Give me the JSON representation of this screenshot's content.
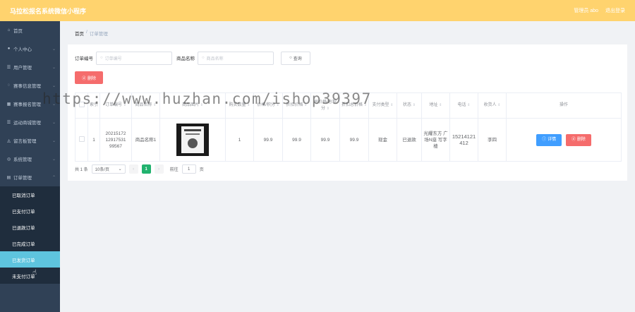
{
  "header": {
    "title": "马拉松报名系统微信小程序",
    "admin_label": "管理员 abo",
    "logout_label": "退出登录"
  },
  "sidebar": {
    "items": [
      {
        "label": "首页",
        "icon": "home-icon",
        "glyph": "⌂"
      },
      {
        "label": "个人中心",
        "icon": "user-icon",
        "glyph": "●"
      },
      {
        "label": "用户管理",
        "icon": "list-icon",
        "glyph": "☰"
      },
      {
        "label": "赛事信息管理",
        "icon": "info-icon",
        "glyph": "◌"
      },
      {
        "label": "赛事报名管理",
        "icon": "calendar-icon",
        "glyph": "▦"
      },
      {
        "label": "运动商城管理",
        "icon": "menu-icon",
        "glyph": "☰"
      },
      {
        "label": "留言板管理",
        "icon": "chat-icon",
        "glyph": "◬"
      },
      {
        "label": "系统管理",
        "icon": "gear-icon",
        "glyph": "◎"
      },
      {
        "label": "订单管理",
        "icon": "order-icon",
        "glyph": "▤"
      }
    ],
    "subitems": [
      {
        "label": "已取消订单"
      },
      {
        "label": "已支付订单"
      },
      {
        "label": "已退款订单"
      },
      {
        "label": "已完成订单"
      },
      {
        "label": "已发货订单"
      },
      {
        "label": "未支付订单"
      }
    ]
  },
  "breadcrumb": {
    "home": "首页",
    "sep": "/",
    "current": "订单管理"
  },
  "search": {
    "order_no_label": "订单编号",
    "order_no_placeholder": "订单编号",
    "product_label": "商品名称",
    "product_placeholder": "商品名称",
    "query_label": "查询",
    "search_glyph": "○"
  },
  "actions": {
    "delete_label": "删除",
    "delete_glyph": "ⓓ"
  },
  "table": {
    "headers": [
      "",
      "索引",
      "订单编号",
      "商品名称",
      "商品图片",
      "购买数量",
      "价格/积分",
      "折扣价格",
      "总价格/总积分",
      "折扣总价格",
      "支付类型",
      "状态",
      "地址",
      "电话",
      "收货人",
      "操作"
    ],
    "sort_glyph": "⇕",
    "rows": [
      {
        "index": "1",
        "order_no": "20215172 12917531 99567",
        "product_name": "商品名称1",
        "quantity": "1",
        "price": "99.9",
        "discount_price": "99.9",
        "total_price": "99.9",
        "discount_total": "99.9",
        "pay_type": "现金",
        "status": "已退款",
        "address": "光耀东方 广场N座 写字楼",
        "phone": "15214121 412",
        "consignee": "李四",
        "detail_label": "详情",
        "delete_label": "删除",
        "detail_glyph": "ⓘ",
        "delete_glyph": "ⓓ"
      }
    ]
  },
  "pagination": {
    "total": "共 1 条",
    "page_size": "10条/页",
    "prev": "‹",
    "current_page": "1",
    "next": "›",
    "goto_label": "前往",
    "goto_value": "1",
    "page_suffix": "页"
  },
  "watermark": "https://www.huzhan.com/ishop39397",
  "colors": {
    "topbar": "#ffd36e",
    "sidebar": "#304156",
    "active_sub": "#5ec4de",
    "danger": "#f56c6c",
    "primary": "#409eff",
    "pager_active": "#21b26e"
  }
}
